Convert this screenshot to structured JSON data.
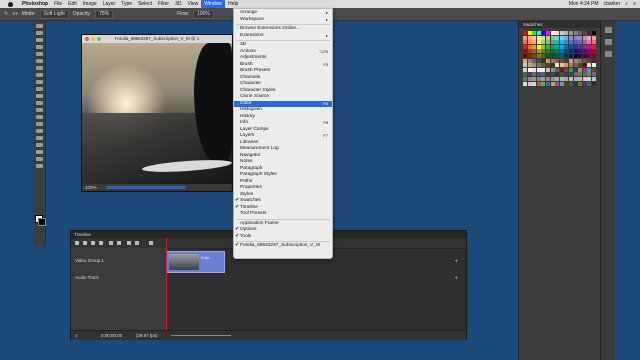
{
  "menubar": {
    "app": "Photoshop",
    "items": [
      "File",
      "Edit",
      "Image",
      "Layer",
      "Type",
      "Select",
      "Filter",
      "3D",
      "View",
      "Window",
      "Help"
    ],
    "active": "Window",
    "time": "Mon 4:24 PM",
    "user": "cbarker"
  },
  "options_bar": {
    "mode_label": "Mode:",
    "mode_value": "Soft Light",
    "opacity_label": "Opacity:",
    "opacity_value": "75%",
    "flow_label": "Flow:",
    "flow_value": "100%"
  },
  "document": {
    "title": "Fotolia_69563297_Subscription_V_M @ 1",
    "zoom": "100%"
  },
  "window_menu": {
    "items": [
      {
        "label": "Arrange",
        "submenu": true
      },
      {
        "label": "Workspace",
        "submenu": true
      },
      {
        "sep": true
      },
      {
        "label": "Browse Extensions Online..."
      },
      {
        "label": "Extensions",
        "submenu": true
      },
      {
        "sep": true
      },
      {
        "label": "3D"
      },
      {
        "label": "Actions",
        "shortcut": "⌥F9"
      },
      {
        "label": "Adjustments"
      },
      {
        "label": "Brush",
        "shortcut": "F5"
      },
      {
        "label": "Brush Presets"
      },
      {
        "label": "Channels"
      },
      {
        "label": "Character"
      },
      {
        "label": "Character Styles"
      },
      {
        "label": "Clone Source"
      },
      {
        "label": "Color",
        "shortcut": "F6",
        "highlight": true
      },
      {
        "label": "Histogram"
      },
      {
        "label": "History"
      },
      {
        "label": "Info",
        "shortcut": "F8"
      },
      {
        "label": "Layer Comps"
      },
      {
        "label": "Layers",
        "shortcut": "F7"
      },
      {
        "label": "Libraries"
      },
      {
        "label": "Measurement Log"
      },
      {
        "label": "Navigator"
      },
      {
        "label": "Notes"
      },
      {
        "label": "Paragraph"
      },
      {
        "label": "Paragraph Styles"
      },
      {
        "label": "Paths"
      },
      {
        "label": "Properties"
      },
      {
        "label": "Styles"
      },
      {
        "label": "Swatches",
        "checked": true
      },
      {
        "label": "Timeline",
        "checked": true
      },
      {
        "label": "Tool Presets"
      },
      {
        "sep": true
      },
      {
        "label": "Application Frame"
      },
      {
        "label": "Options",
        "checked": true
      },
      {
        "label": "Tools",
        "checked": true
      },
      {
        "sep": true
      },
      {
        "label": "Fotolia_69563297_Subscription_V_M",
        "checked": true
      }
    ]
  },
  "swatches_panel": {
    "tab": "Swatches",
    "colors": [
      "#ff0000",
      "#ffff00",
      "#00ff00",
      "#00ffff",
      "#0000ff",
      "#ff00ff",
      "#ffffff",
      "#e6e6e6",
      "#cccccc",
      "#b3b3b3",
      "#999999",
      "#808080",
      "#666666",
      "#4d4d4d",
      "#333333",
      "#000000",
      "#f7977a",
      "#f9ad81",
      "#fdc68a",
      "#fff79a",
      "#c4df9b",
      "#a2d39c",
      "#82ca9d",
      "#7bcdc8",
      "#6ecff6",
      "#7ea7d8",
      "#8493ca",
      "#8882be",
      "#a187be",
      "#bc8dbf",
      "#f49ac2",
      "#f6989d",
      "#f26c4f",
      "#f68e55",
      "#fbaf5c",
      "#fff467",
      "#acd372",
      "#7cc576",
      "#3bb878",
      "#1abbb4",
      "#00bff3",
      "#438cca",
      "#5574b9",
      "#605ca8",
      "#855fa8",
      "#a763a8",
      "#f06ea9",
      "#f26d7d",
      "#ed1c24",
      "#f26522",
      "#f7941d",
      "#fff200",
      "#8dc73f",
      "#39b54a",
      "#00a651",
      "#00a99d",
      "#00aeef",
      "#0072bc",
      "#0054a6",
      "#2e3192",
      "#662d91",
      "#92278f",
      "#ec008c",
      "#ed145b",
      "#9e0b0f",
      "#a0410d",
      "#a36209",
      "#aba000",
      "#598527",
      "#1a7b30",
      "#007236",
      "#00746b",
      "#0076a3",
      "#004b80",
      "#003471",
      "#1b1464",
      "#440e62",
      "#630460",
      "#9e005d",
      "#9e0039",
      "#790000",
      "#7b2e00",
      "#7d4900",
      "#827b00",
      "#406618",
      "#005e20",
      "#005826",
      "#005952",
      "#005b7f",
      "#003663",
      "#002157",
      "#0d004c",
      "#32004b",
      "#4b0049",
      "#7b0046",
      "#7a0026",
      "#c7b299",
      "#998675",
      "#736357",
      "#534741",
      "#37302d",
      "#c69c6d",
      "#a67c52",
      "#8c6239",
      "#754c24",
      "#603913",
      "#c0a080",
      "#a58568",
      "#8a6f55",
      "#6f5a46",
      "#554536",
      "#3b3026",
      "#d4c5b0",
      "#b8a892",
      "#9d8c77",
      "#83725e",
      "#6a5a48",
      "#524436",
      "#3c3126",
      "#ffe0c0",
      "#e0c0a0",
      "#c0a080",
      "#a08060",
      "#806040",
      "#604020",
      "#402000",
      "#ffd0d0",
      "#d0ffd0",
      "#d0d0ff",
      "#ffffd0",
      "#ffd0ff",
      "#d0ffff",
      "#f0f0f0",
      "#c0c0c0",
      "#909090",
      "#606060",
      "#303030",
      "#a03030",
      "#30a030",
      "#3030a0",
      "#a0a030",
      "#a030a0",
      "#30a0a0",
      "#704040",
      "#407040",
      "#404070",
      "#707040",
      "#704070",
      "#407070",
      "#503030",
      "#305030",
      "#303050",
      "#505030",
      "#503050",
      "#305050",
      "#806060",
      "#608060",
      "#606080",
      "#808060",
      "#806080",
      "#608080",
      "#a08080",
      "#80a080",
      "#8080a0",
      "#a0a080",
      "#a080a0",
      "#80a0a0",
      "#c0a0a0",
      "#a0c0a0",
      "#a0a0c0",
      "#c0c0a0",
      "#c0a0c0",
      "#a0c0c0",
      "#e0c0c0",
      "#c0e0c0",
      "#c0c0e0",
      "#e0e0c0",
      "#e0c0e0",
      "#c0e0e0",
      "#b06040",
      "#60b040",
      "#4060b0",
      "#b0b040",
      "#b040b0",
      "#40b0b0",
      "#703020",
      "#207030",
      "#203070",
      "#707020",
      "#702070",
      "#207070",
      "#402010"
    ]
  },
  "timeline": {
    "tab": "Timeline",
    "track1": "Video Group 1",
    "track2": "Audio Track",
    "clip_name": "Foto...",
    "timecode": "0;00;00;00",
    "fps": "(29.97 fps)"
  }
}
